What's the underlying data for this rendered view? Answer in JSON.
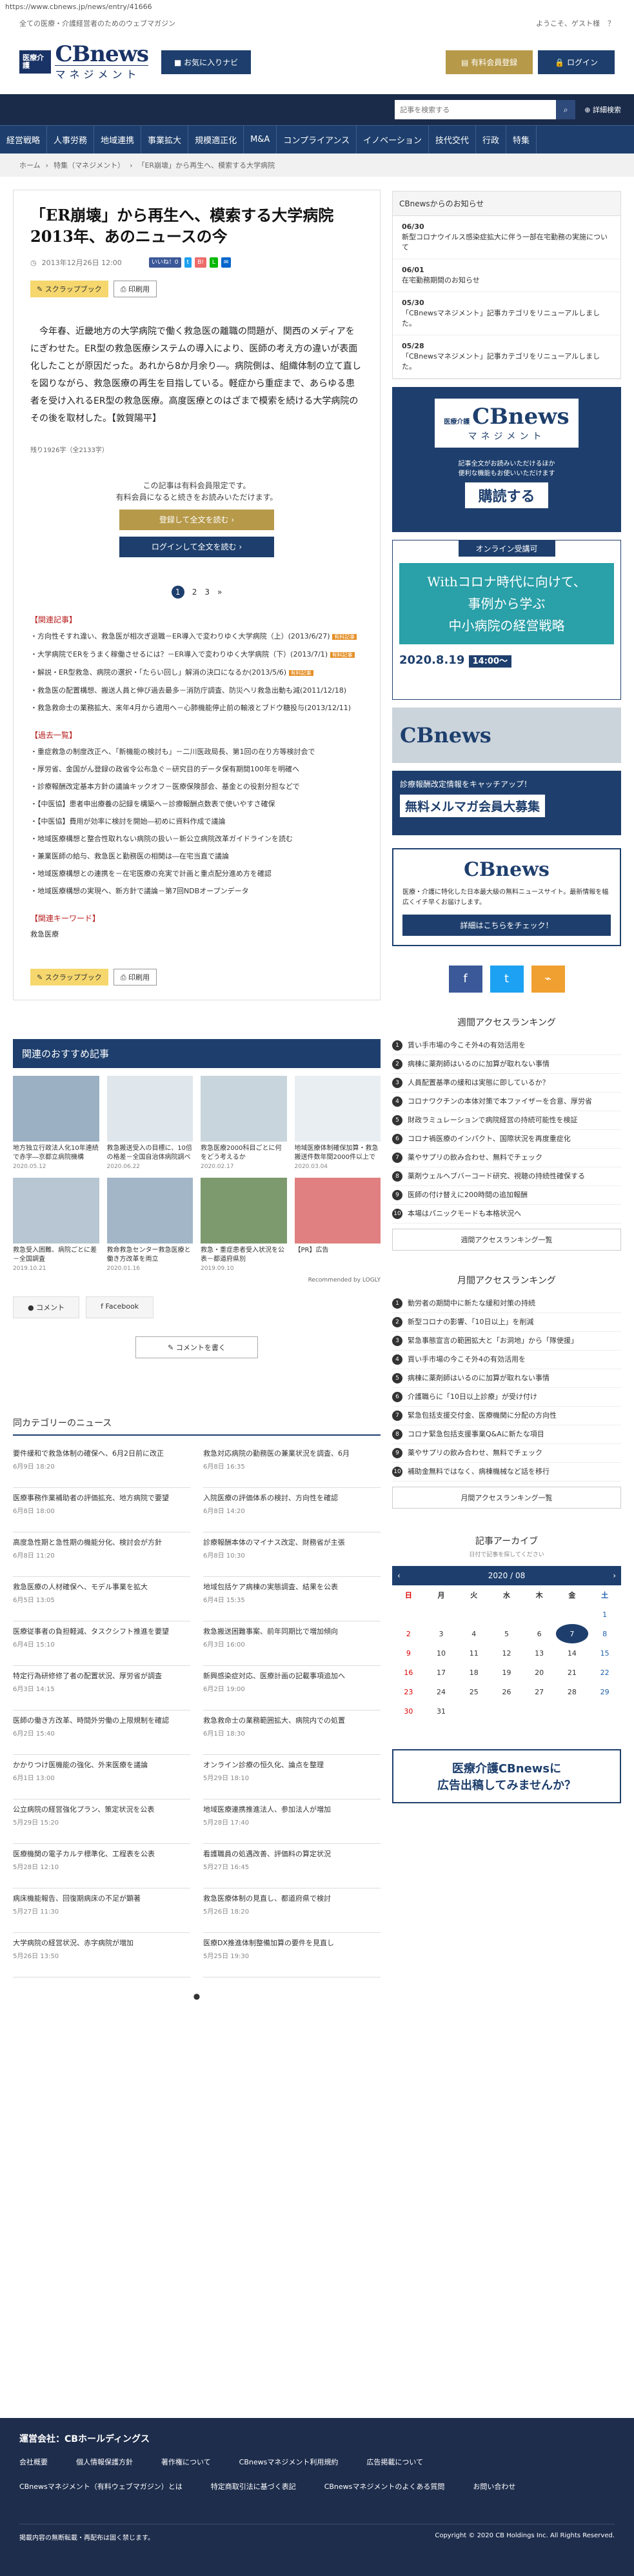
{
  "browser": {
    "url": "https://www.cbnews.jp/news/entry/41666"
  },
  "topstrip": {
    "tagline": "全ての医療・介護経営者のためのウェブマガジン",
    "welcome": "ようこそ、ゲスト様"
  },
  "logo": {
    "badge": "医療介護",
    "brand": "CBnews",
    "sub": "マネジメント"
  },
  "header": {
    "favorite": "お気に入りナビ",
    "membership": "有料会員登録",
    "login": "ログイン"
  },
  "search": {
    "placeholder": "記事を検索する",
    "advanced": "詳細検索"
  },
  "nav": [
    "経営戦略",
    "人事労務",
    "地域連携",
    "事業拡大",
    "規模適正化",
    "M&A",
    "コンプライアンス",
    "イノベーション",
    "技代交代",
    "行政",
    "特集"
  ],
  "breadcrumb": [
    "ホーム",
    "特集（マネジメント）",
    "「ER崩壊」から再生へ、模索する大学病院"
  ],
  "article": {
    "title": "「ER崩壊」から再生へ、模索する大学病院　2013年、あのニュースの今",
    "date": "2013年12月26日 12:00",
    "like": "いいね！0",
    "tag_scrap": "スクラップブック",
    "tag_print": "印刷用",
    "body": "今年春、近畿地方の大学病院で働く救急医の離職の問題が、関西のメディアをにぎわせた。ER型の救急医療システムの導入により、医師の考え方の違いが表面化したことが原因だった。あれから8か月余り―。病院側は、組織体制の立て直しを図りながら、救急医療の再生を目指している。軽症から重症まで、あらゆる患者を受け入れるER型の救急医療。高度医療とのはざまで模索を続ける大学病院のその後を取材した。【敦賀陽平】",
    "chars": "残り1926字（全2133字）",
    "locked1": "この記事は有料会員限定です。",
    "locked2": "有料会員になると続きをお読みいただけます。",
    "register_btn": "登録して全文を読む ›",
    "login_btn": "ログインして全文を読む ›",
    "pages": [
      "1",
      "2",
      "3",
      "»"
    ]
  },
  "related": {
    "head": "【関連記事】",
    "items": [
      {
        "text": "方向性そすれ違い、救急医が相次ぎ退職－ER導入で変わりゆく大学病院（上）(2013/6/27)",
        "badge": "有料記事"
      },
      {
        "text": "大学病院でERをうまく稼働させるには？－ER導入で変わりゆく大学病院（下）(2013/7/1)",
        "badge": "有料記事"
      },
      {
        "text": "解説・ER型救急、病院の選択・「たらい回し」解消の決口になるか(2013/5/6)",
        "badge": "有料記事"
      },
      {
        "text": "救急医の配置構想、搬送人員と伸び過去最多－消防庁調査、防災ヘリ救急出動も減(2011/12/18)",
        "badge": ""
      },
      {
        "text": "救急救命士の業務拡大、来年4月から適用へ－心肺機能停止前の輸液とブドウ糖投与(2013/12/11)",
        "badge": ""
      }
    ],
    "head2": "【過去一覧】",
    "items2": [
      "重症救急の制度改正へ、「新機能の検討も」－二川医政局長、第1回の在り方等検討会で",
      "厚労省、金国がん登録の政省令公布急ぐ－研究目的データ保有期間100年を明確へ",
      "診療報酬改定基本方針の議論キックオフ－医療保険部会、基金との役割分担などで",
      "【中医協】患者申出療養の記録を構築へ－診療報酬点数表で使いやすさ確保",
      "【中医協】費用が効率に検討を開始―初めに資料作成で議論",
      "地域医療構想と整合性取れない病院の扱い－新公立病院改革ガイドラインを読む",
      "兼業医師の給与、救急医と勤務医の相関は―在宅当直で議論",
      "地域医療構想との連携を－在宅医療の充実で計画と重点配分進め方を確認",
      "地域医療構想の実現へ、新方針で議論－第7回NDBオープンデータ"
    ],
    "kw_head": "【関連キーワード】",
    "kw": "救急医療"
  },
  "recommend": {
    "title": "関連のおすすめ記事",
    "items": [
      {
        "caption": "地方独立行政法人化10年連続で赤字―京都立病院機構",
        "date": "2020.05.12"
      },
      {
        "caption": "救急搬送受入の目標に、10倍の格差－全国自治体病院調べ",
        "date": "2020.06.22"
      },
      {
        "caption": "救急医療2000科目ごとに何をどう考えるか",
        "date": "2020.02.17"
      },
      {
        "caption": "地域医療体制確保加算・救急搬送件数年間2000件以上で",
        "date": "2020.03.04"
      },
      {
        "caption": "救急受入困難、病院ごとに差－全国調査",
        "date": "2019.10.21"
      },
      {
        "caption": "救命救急センター救急医療と働き方改革を両立",
        "date": "2020.01.16"
      },
      {
        "caption": "救急・重症患者受入状況を公表－都道府県別",
        "date": "2019.09.10"
      },
      {
        "caption": "【PR】広告",
        "date": ""
      }
    ],
    "by": "Recommended by LOGLY"
  },
  "comment": {
    "tab1": "コメント",
    "tab2": "Facebook",
    "write": "コメントを書く"
  },
  "category": {
    "title": "同カテゴリーのニュース",
    "items": [
      {
        "t": "要件緩和で救急体制の確保へ、6月2日前に改正",
        "d": "6月9日 18:20"
      },
      {
        "t": "救急対応病院の勤務医の兼業状況を調査、6月",
        "d": "6月8日 16:35"
      },
      {
        "t": "医療事務作業補助者の評価拡充、地方病院で要望",
        "d": "6月8日 18:00"
      },
      {
        "t": "入院医療の評価体系の検討、方向性を確認",
        "d": "6月8日 14:20"
      },
      {
        "t": "高度急性期と急性期の機能分化、検討会が方針",
        "d": "6月8日 11:20"
      },
      {
        "t": "診療報酬本体のマイナス改定、財務省が主張",
        "d": "6月8日 10:30"
      },
      {
        "t": "救急医療の人材確保へ、モデル事業を拡大",
        "d": "6月5日 13:05"
      },
      {
        "t": "地域包括ケア病棟の実態調査、結果を公表",
        "d": "6月4日 15:35"
      },
      {
        "t": "医療従事者の負担軽減、タスクシフト推進を要望",
        "d": "6月4日 15:10"
      },
      {
        "t": "救急搬送困難事案、前年同期比で増加傾向",
        "d": "6月3日 16:00"
      },
      {
        "t": "特定行為研修修了者の配置状況、厚労省が調査",
        "d": "6月3日 14:15"
      },
      {
        "t": "新興感染症対応、医療計画の記載事項追加へ",
        "d": "6月2日 19:00"
      },
      {
        "t": "医師の働き方改革、時間外労働の上限規制を確認",
        "d": "6月2日 15:40"
      },
      {
        "t": "救急救命士の業務範囲拡大、病院内での処置",
        "d": "6月1日 18:30"
      },
      {
        "t": "かかりつけ医機能の強化、外来医療を議論",
        "d": "6月1日 13:00"
      },
      {
        "t": "オンライン診療の恒久化、論点を整理",
        "d": "5月29日 18:10"
      },
      {
        "t": "公立病院の経営強化プラン、策定状況を公表",
        "d": "5月29日 15:20"
      },
      {
        "t": "地域医療連携推進法人、参加法人が増加",
        "d": "5月28日 17:40"
      },
      {
        "t": "医療機関の電子カルテ標準化、工程表を公表",
        "d": "5月28日 12:10"
      },
      {
        "t": "看護職員の処遇改善、評価料の算定状況",
        "d": "5月27日 16:45"
      },
      {
        "t": "病床機能報告、回復期病床の不足が顕著",
        "d": "5月27日 11:30"
      },
      {
        "t": "救急医療体制の見直し、都道府県で検討",
        "d": "5月26日 18:20"
      },
      {
        "t": "大学病院の経営状況、赤字病院が増加",
        "d": "5月26日 13:50"
      },
      {
        "t": "医療DX推進体制整備加算の要件を見直し",
        "d": "5月25日 19:30"
      }
    ]
  },
  "sidebar": {
    "notice_title": "CBnewsからのお知らせ",
    "notices": [
      {
        "date": "06/30",
        "text": "新型コロナウイルス感染症拡大に伴う一部在宅勤務の実施について"
      },
      {
        "date": "06/01",
        "text": "在宅勤務期間のお知らせ"
      },
      {
        "date": "05/30",
        "text": "「CBnewsマネジメント」記事カテゴリをリニューアルしました。"
      },
      {
        "date": "05/28",
        "text": "「CBnewsマネジメント」記事カテゴリをリニューアルしました。"
      }
    ],
    "ad1_line1": "記事全文がお読みいただけるほか",
    "ad1_line2": "便利な機能もお使いいただけます",
    "ad1_btn": "購読する",
    "seminar": {
      "tag": "オンライン受講可",
      "title1": "Withコロナ時代に向けて、",
      "title2": "事例から学ぶ",
      "title3": "中小病院の経営戦略",
      "date": "2020.8.19",
      "time": "14:00〜"
    },
    "mag_title": "CBnews",
    "mag_badge": "無料メルマガ会員大募集",
    "mag_text": "診療報酬改定情報をキャッチアップ！",
    "promo_text": "医療・介護に特化した日本最大級の無料ニュースサイト。最新情報を幅広くイチ早くお届けします。",
    "promo_btn": "詳細はこちらをチェック！",
    "rank_week": "週間アクセスランキング",
    "week": [
      "賃い手市場の今こそ外4の有効活用を",
      "病棟に薬剤師はいるのに加算が取れない事情",
      "人員配置基準の緩和は実態に即しているか？",
      "コロナワクチンの本体対策で本ファイザーを合意、厚労省",
      "財政ラミュレーションで病院経営の持続可能性を検証",
      "コロナ禍医療のインパクト、国際状況を再度重症化",
      "薬やサプリの飲み合わせ、無料でチェック",
      "薬剤ウェルヘブバーコード研究、視聴の持続性確保する",
      "医師の付け替えに200時間の追加報酬",
      "本場はパニックモードも本格状況へ"
    ],
    "rank_week_link": "週間アクセスランキング一覧",
    "rank_month": "月間アクセスランキング",
    "month": [
      "動労者の期間中に新たな緩和対策の持続",
      "新型コロナの影響、「10日以上」を削減",
      "緊急事態宣言の範囲拡大と「お洞地」から「隊使援」",
      "買い手市場の今こそ外4の有効活用を",
      "病棟に薬剤師はいるのに加算が取れない事情",
      "介護職らに「10日以上診療」が受け付け",
      "緊急包括支援交付金、医療機関に分配の方向性",
      "コロナ緊急包括支援事業Q&Aに新たな項目",
      "薬やサプリの飲み合わせ、無料でチェック",
      "補助金無料ではなく、病棟機械など話を移行"
    ],
    "rank_month_link": "月間アクセスランキング一覧",
    "archive": "記事アーカイブ",
    "archive_sub": "日付で記事を探してください",
    "cal_title": "2020 / 08",
    "weekdays": [
      "日",
      "月",
      "火",
      "水",
      "木",
      "金",
      "土"
    ],
    "ad_bottom1": "医療介護CBnewsに",
    "ad_bottom2": "広告出稿してみませんか？"
  },
  "footer": {
    "company": "運営会社：CBホールディングス",
    "links": [
      "会社概要",
      "個人情報保護方針",
      "著作権について",
      "CBnewsマネジメント利用規約",
      "広告掲載について",
      "CBnewsマネジメント（有料ウェブマガジン）とは",
      "特定商取引法に基づく表記",
      "CBnewsマネジメントのよくある質問",
      "お問い合わせ"
    ],
    "note": "掲載内容の無断転載・再配布は固く禁じます。",
    "copyright": "Copyright © 2020 CB Holdings Inc. All Rights Reserved."
  },
  "colors": {
    "navy": "#1e3f6d",
    "gold": "#b69949",
    "dark": "#1a2b4a"
  }
}
